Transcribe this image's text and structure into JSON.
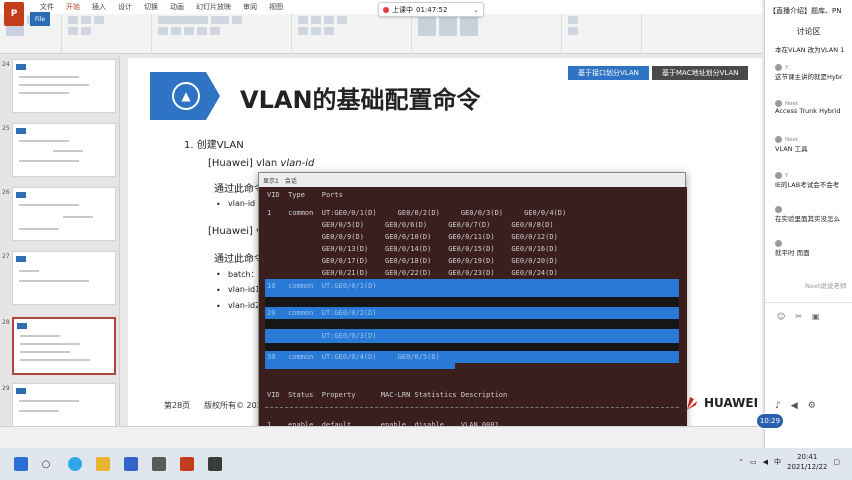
{
  "ribbon": {
    "tabs": [
      "文件",
      "开始",
      "插入",
      "设计",
      "切换",
      "动画",
      "幻灯片放映",
      "审阅",
      "视图"
    ],
    "file_label": "File"
  },
  "live": {
    "status": "上课中",
    "elapsed": "01:47:52"
  },
  "slide": {
    "title": "VLAN的基础配置命令",
    "nav_tabs": [
      "基于接口划分VLAN",
      "基于MAC地址划分VLAN"
    ],
    "item1": "1.   创建VLAN",
    "cmd1_prefix": "[Huawei] vlan ",
    "cmd1_arg": "vlan-id",
    "desc1": "通过此命令",
    "bullet1": "vlan-id",
    "cmd2_prefix": "[Huawei] vla",
    "desc2": "通过此命令",
    "bullet2a": "batch：",
    "bullet2b": "vlan-id1",
    "bullet2c": "vlan-id2",
    "page": "第28页",
    "copyright": "版权所有© 2020",
    "brand": "HUAWEI"
  },
  "terminal": {
    "tabs": [
      "显示1",
      "会话"
    ],
    "header": "VID  Type    Ports",
    "rows": [
      "1    common  UT:GE0/0/1(D)     GE0/0/2(D)     GE0/0/3(D)     GE0/0/4(D)",
      "             GE0/0/5(D)     GE0/0/6(D)     GE0/0/7(D)     GE0/0/8(D)",
      "             GE0/0/9(D)     GE0/0/10(D)    GE0/0/11(D)    GE0/0/12(D)",
      "             GE0/0/13(D)    GE0/0/14(D)    GE0/0/15(D)    GE0/0/16(D)",
      "             GE0/0/17(D)    GE0/0/18(D)    GE0/0/19(D)    GE0/0/20(D)",
      "             GE0/0/21(D)    GE0/0/22(D)    GE0/0/23(D)    GE0/0/24(D)"
    ],
    "hl_rows": [
      "10   common  UT:GE0/0/1(D)",
      "20   common  UT:GE0/0/2(D)",
      "             UT:GE0/0/3(D)",
      "30   common  UT:GE0/0/4(D)     GE0/0/5(D)"
    ],
    "footer_header": "VID  Status  Property      MAC-LRN Statistics Description",
    "footer_row": "1    enable  default       enable  disable    VLAN 0001"
  },
  "chat": {
    "header": "【直播介绍】题库、PN",
    "title": "讨论区",
    "messages": [
      {
        "who": "",
        "text": "本在VLAN 改为VLAN 1"
      },
      {
        "who": "Y",
        "text": "这节课主讲的就是Hybr"
      },
      {
        "who": "Neet",
        "text": "Access Trunk Hybrid"
      },
      {
        "who": "Neet",
        "text": "VLAN 工具"
      },
      {
        "who": "Y",
        "text": "IE的LAB考试会不会考"
      },
      {
        "who": "",
        "text": "在实验里面其实没怎么"
      },
      {
        "who": "",
        "text": "就平时 而面"
      }
    ],
    "placeholder": "Neet说说老师"
  },
  "timer": "10:29",
  "taskbar": {
    "lang": "中",
    "time": "20:41",
    "date": "2021/12/22"
  }
}
